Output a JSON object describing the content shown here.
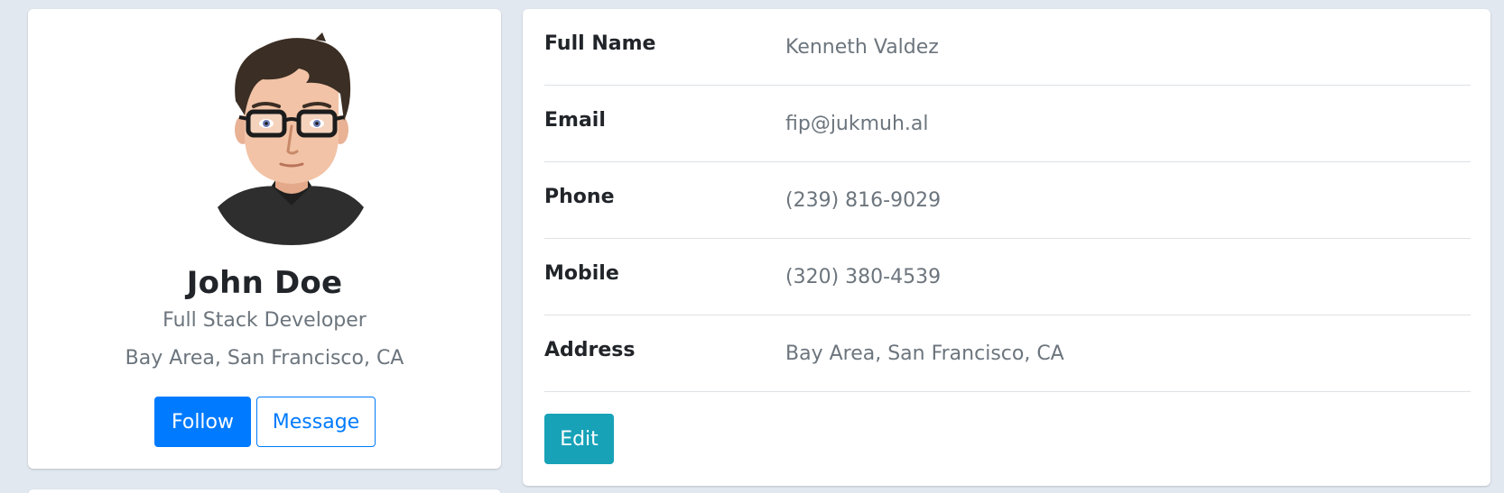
{
  "profile": {
    "name": "John Doe",
    "title": "Full Stack Developer",
    "location": "Bay Area, San Francisco, CA",
    "follow_label": "Follow",
    "message_label": "Message"
  },
  "details": {
    "rows": [
      {
        "label": "Full Name",
        "value": "Kenneth Valdez"
      },
      {
        "label": "Email",
        "value": "fip@jukmuh.al"
      },
      {
        "label": "Phone",
        "value": "(239) 816-9029"
      },
      {
        "label": "Mobile",
        "value": "(320) 380-4539"
      },
      {
        "label": "Address",
        "value": "Bay Area, San Francisco, CA"
      }
    ],
    "edit_label": "Edit"
  },
  "colors": {
    "primary": "#007bff",
    "info": "#17a2b8",
    "page_background": "#e2e8f0",
    "muted_text": "#6c757d"
  }
}
